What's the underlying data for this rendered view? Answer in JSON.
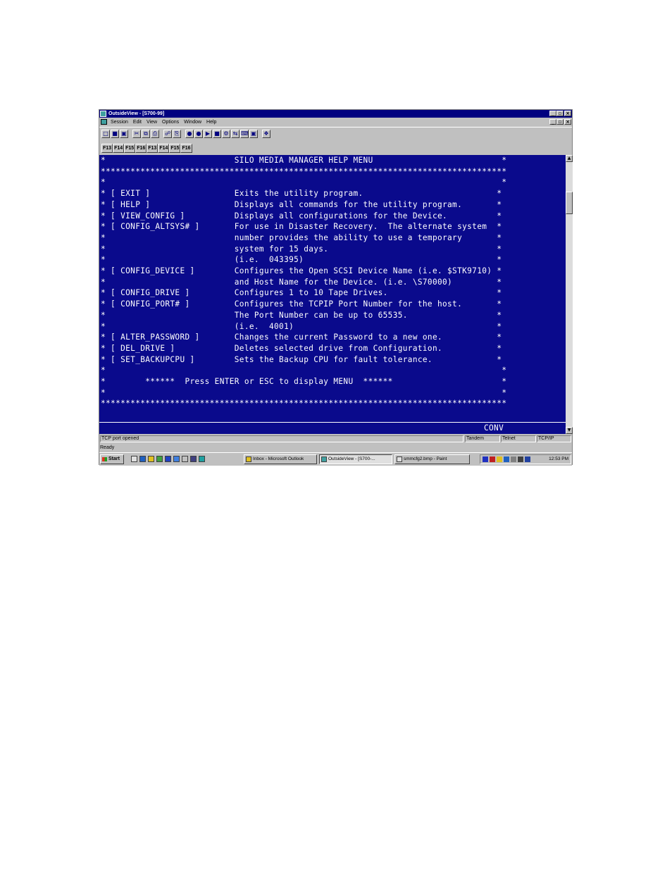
{
  "window": {
    "title": "OutsideView - [S700-99]",
    "minimize_glyph": "_",
    "maximize_glyph": "▫",
    "close_glyph": "×",
    "icon": "outsideview-app-icon"
  },
  "menu": {
    "items": [
      "Session",
      "Edit",
      "View",
      "Options",
      "Window",
      "Help"
    ],
    "doc_controls": [
      "_",
      "▫",
      "×"
    ]
  },
  "toolbar": {
    "icons": [
      "new-icon",
      "open-icon",
      "save-icon",
      "cut-icon",
      "copy-icon",
      "print-icon",
      "connect-icon",
      "disconnect-icon",
      "macro-icon",
      "record-icon",
      "play-icon",
      "stop-icon",
      "settings-icon",
      "transfer-icon",
      "keyboard-icon",
      "screen-icon",
      "help-book-icon"
    ]
  },
  "fkeys": [
    "F13",
    "F14",
    "F15",
    "F16",
    "F13",
    "F14",
    "F15",
    "F16"
  ],
  "terminal": {
    "lines": [
      "*                          SILO MEDIA MANAGER HELP MENU                          *",
      "**********************************************************************************",
      "*                                                                                *",
      "* [ EXIT ]                 Exits the utility program.                           *",
      "* [ HELP ]                 Displays all commands for the utility program.       *",
      "* [ VIEW_CONFIG ]          Displays all configurations for the Device.          *",
      "* [ CONFIG_ALTSYS# ]       For use in Disaster Recovery.  The alternate system  *",
      "*                          number provides the ability to use a temporary       *",
      "*                          system for 15 days.                                  *",
      "*                          (i.e.  043395)                                       *",
      "* [ CONFIG_DEVICE ]        Configures the Open SCSI Device Name (i.e. $STK9710) *",
      "*                          and Host Name for the Device. (i.e. \\S70000)         *",
      "* [ CONFIG_DRIVE ]         Configures 1 to 10 Tape Drives.                      *",
      "* [ CONFIG_PORT# ]         Configures the TCPIP Port Number for the host.       *",
      "*                          The Port Number can be up to 65535.                  *",
      "*                          (i.e.  4001)                                         *",
      "* [ ALTER_PASSWORD ]       Changes the current Password to a new one.           *",
      "* [ DEL_DRIVE ]            Deletes selected drive from Configuration.           *",
      "* [ SET_BACKUPCPU ]        Sets the Backup CPU for fault tolerance.             *",
      "*                                                                                *",
      "*        ******  Press ENTER or ESC to display MENU  ******                      *",
      "*                                                                                *",
      "**********************************************************************************"
    ],
    "mode": "CONV"
  },
  "statusbar": {
    "message": "TCP port opened",
    "host_type": "Tandem",
    "protocol": "Telnet",
    "transport": "TCP/IP",
    "ready": "Ready"
  },
  "taskbar": {
    "start": "Start",
    "tasks": [
      {
        "label": "Inbox - Microsoft Outlook",
        "icon": "outlook-icon"
      },
      {
        "label": "OutsideView - [S700-...",
        "icon": "outsideview-icon"
      },
      {
        "label": "smmcfg2.bmp - Paint",
        "icon": "paint-icon"
      }
    ],
    "clock": "12:53 PM"
  }
}
